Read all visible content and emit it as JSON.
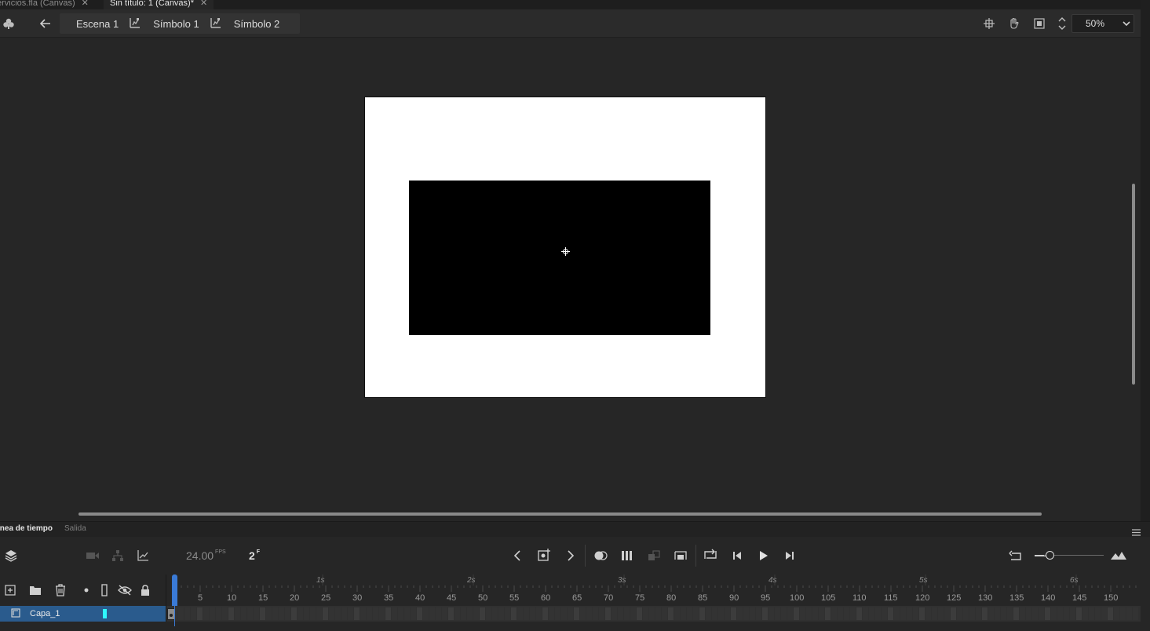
{
  "doc_tabs": [
    {
      "label": "ervicios.fla (Canvas)"
    },
    {
      "label": "Sin título: 1 (Canvas)*"
    }
  ],
  "editbar": {
    "breadcrumbs": [
      "Escena 1",
      "Símbolo 1",
      "Símbolo 2"
    ],
    "zoom_value": "50%"
  },
  "panel_tabs": {
    "timeline": "ínea de tiempo",
    "output": "Salida"
  },
  "timeline": {
    "fps_value": "24.00",
    "fps_unit": "FPS",
    "current_frame": "2",
    "frame_unit": "F",
    "seconds": [
      "1s",
      "2s",
      "3s",
      "4s",
      "5s",
      "6s"
    ],
    "frame_numbers": [
      "5",
      "10",
      "15",
      "20",
      "25",
      "30",
      "35",
      "40",
      "45",
      "50",
      "55",
      "60",
      "65",
      "70",
      "75",
      "80",
      "85",
      "90",
      "95",
      "100",
      "105",
      "110",
      "115",
      "120",
      "125",
      "130",
      "135",
      "140",
      "145",
      "150"
    ]
  },
  "layers": [
    {
      "name": "Capa_1",
      "color": "#2ff8ff"
    }
  ],
  "colors": {
    "layer_selected": "#2a5b8d",
    "playhead": "#3a7ad6",
    "stage": "#ffffff",
    "symbol_fill": "#000000"
  }
}
